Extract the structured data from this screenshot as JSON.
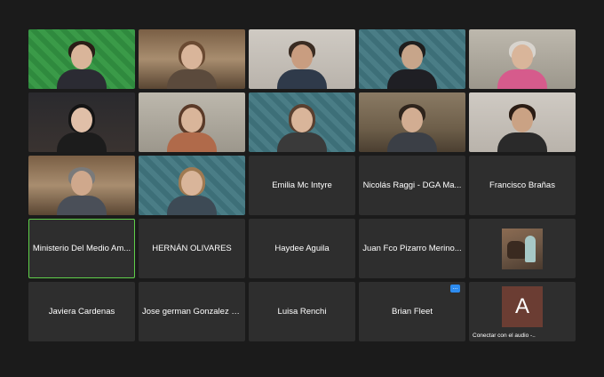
{
  "participants": {
    "row3": {
      "emilia": "Emilia Mc Intyre",
      "nicolas": "Nicolás Raggi - DGA Ma...",
      "francisco": "Francisco Brañas"
    },
    "row4": {
      "ministerio": "Ministerio Del Medio Am...",
      "hernan": "HERNÁN OLIVARES",
      "haydee": "Haydee Aguila",
      "juan": "Juan Fco Pizarro Merino..."
    },
    "row5": {
      "javiera": "Javiera Cardenas",
      "jose": "Jose german Gonzalez c...",
      "luisa": "Luisa Renchi",
      "brian": "Brian Fleet"
    },
    "avatar_tile": {
      "letter": "A",
      "caption": "Conectar con el audio  -.."
    },
    "brian_badge": "..."
  },
  "colors": {
    "active_speaker_border": "#5fd04a",
    "tile_bg": "#2e2e2e",
    "window_bg": "#1b1b1b",
    "avatar_bg": "#6b3d33"
  }
}
